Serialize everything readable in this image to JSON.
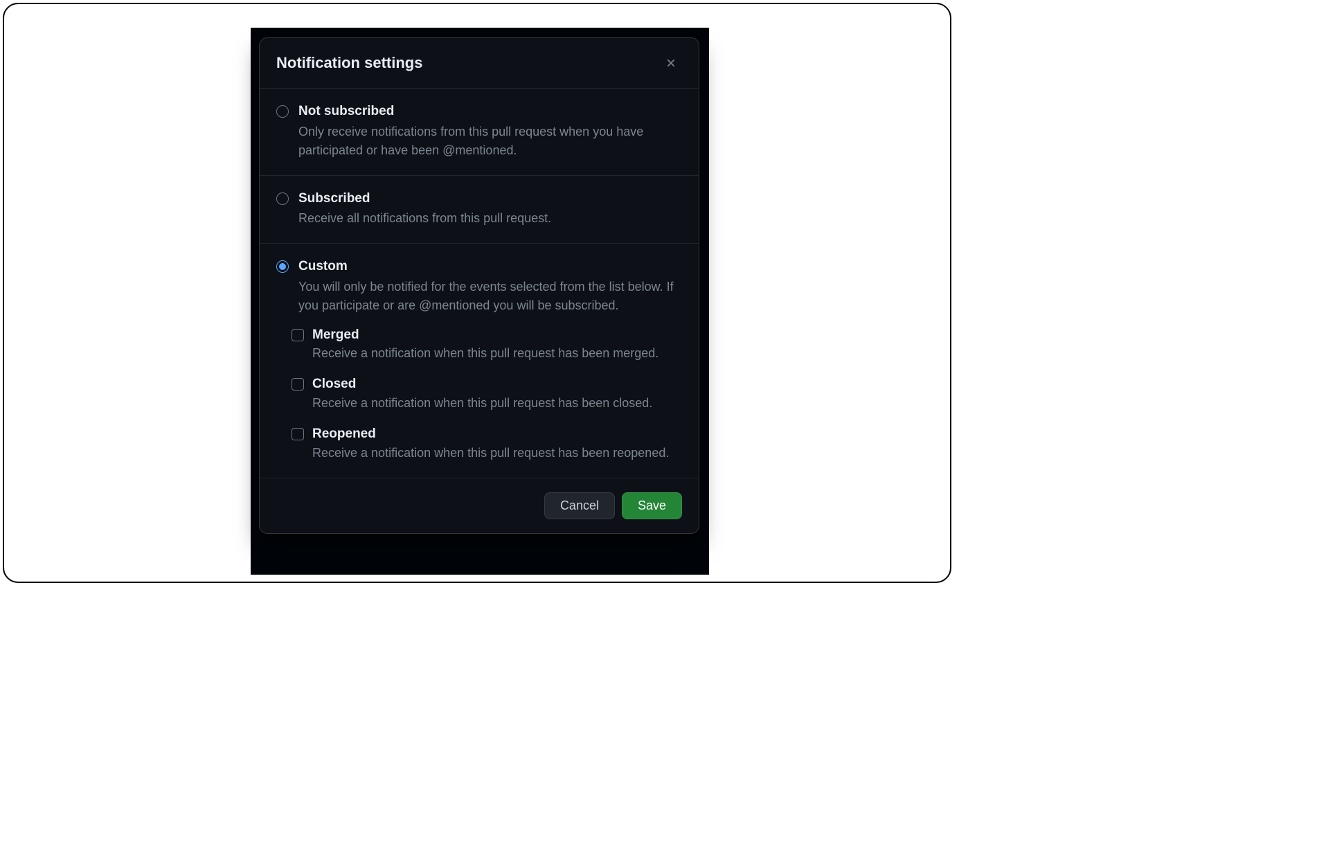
{
  "dialog": {
    "title": "Notification settings",
    "options": [
      {
        "label": "Not subscribed",
        "description": "Only receive notifications from this pull request when you have participated or have been @mentioned.",
        "checked": false
      },
      {
        "label": "Subscribed",
        "description": "Receive all notifications from this pull request.",
        "checked": false
      },
      {
        "label": "Custom",
        "description": "You will only be notified for the events selected from the list below. If you participate or are @mentioned you will be subscribed.",
        "checked": true
      }
    ],
    "custom_events": [
      {
        "label": "Merged",
        "description": "Receive a notification when this pull request has been merged.",
        "checked": false
      },
      {
        "label": "Closed",
        "description": "Receive a notification when this pull request has been closed.",
        "checked": false
      },
      {
        "label": "Reopened",
        "description": "Receive a notification when this pull request has been reopened.",
        "checked": false
      }
    ],
    "footer": {
      "cancel": "Cancel",
      "save": "Save"
    }
  }
}
